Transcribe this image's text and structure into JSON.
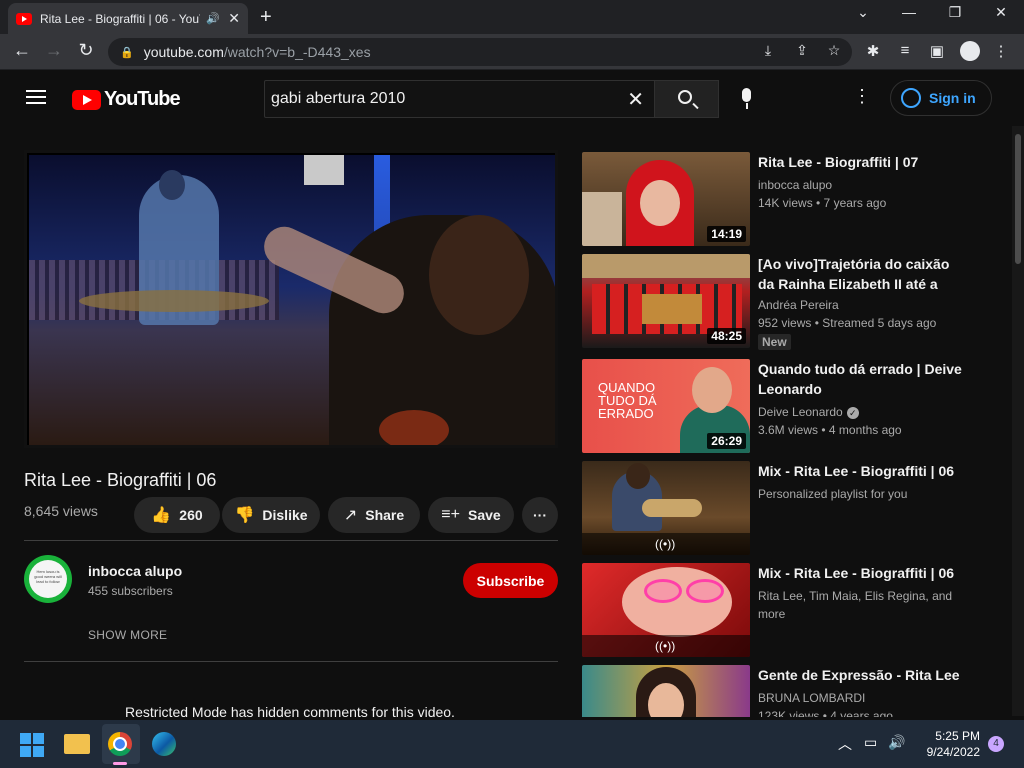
{
  "browser": {
    "tab_title": "Rita Lee - Biograffiti | 06 - YouTube",
    "url_host": "youtube.com",
    "url_path": "/watch?v=b_-D443_xes"
  },
  "header": {
    "logo_text": "YouTube",
    "search_query": "gabi abertura 2010",
    "signin_label": "Sign in"
  },
  "video": {
    "title": "Rita Lee - Biograffiti | 06",
    "views": "8,645 views",
    "likes": "260",
    "dislike_label": "Dislike",
    "share_label": "Share",
    "save_label": "Save",
    "more_label": "···"
  },
  "channel": {
    "name": "inbocca alupo",
    "subscribers": "455 subscribers",
    "subscribe_label": "Subscribe",
    "show_more_label": "SHOW MORE",
    "avatar_text": "Hem lusou is good weera will lead to follow"
  },
  "comments_notice": "Restricted Mode has hidden comments for this video.",
  "recommendations": [
    {
      "title": "Rita Lee - Biograffiti | 07",
      "channel": "inbocca alupo",
      "meta": "14K views • 7 years ago",
      "duration": "14:19"
    },
    {
      "title": "[Ao vivo]Trajetória do caixão da Rainha Elizabeth II até a Abadi...",
      "channel": "Andréa Pereira",
      "meta": "952 views • Streamed 5 days ago",
      "badge": "New",
      "duration": "48:25"
    },
    {
      "title": "Quando tudo dá errado | Deive Leonardo",
      "channel": "Deive Leonardo",
      "meta": "3.6M views • 4 months ago",
      "duration": "26:29",
      "thumb_text": "QUANDO TUDO DÁ ERRADO"
    },
    {
      "title": "Mix - Rita Lee - Biograffiti | 06",
      "channel": "Personalized playlist for you",
      "meta": ""
    },
    {
      "title": "Mix - Rita Lee - Biograffiti | 06",
      "channel": "Rita Lee, Tim Maia, Elis Regina, and more",
      "meta": ""
    },
    {
      "title": "Gente de Expressão - Rita Lee",
      "channel": "BRUNA LOMBARDI",
      "meta": "123K views • 4 years ago"
    }
  ],
  "taskbar": {
    "time": "5:25 PM",
    "date": "9/24/2022",
    "notification_count": "4"
  },
  "colors": {
    "background": "#0f0f0f",
    "subscribe": "#cc0000",
    "signin": "#3ea6ff",
    "pill": "#272727"
  }
}
